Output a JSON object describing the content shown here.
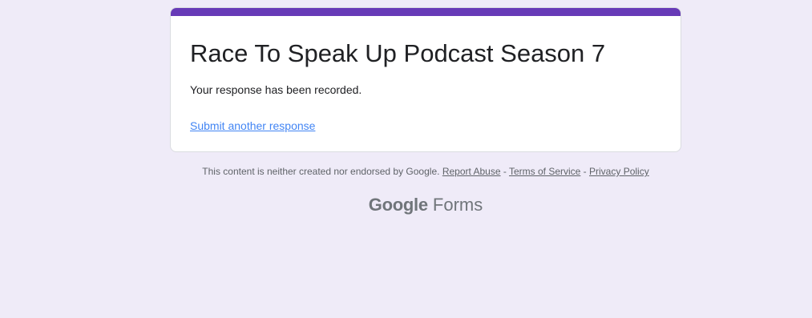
{
  "form": {
    "title": "Race To Speak Up Podcast Season 7",
    "confirmation_message": "Your response has been recorded.",
    "submit_another_label": "Submit another response",
    "accent_color": "#673ab7"
  },
  "footer": {
    "disclaimer": "This content is neither created nor endorsed by Google.",
    "links": {
      "report_abuse": "Report Abuse",
      "terms": "Terms of Service",
      "privacy": "Privacy Policy"
    },
    "separator": " - "
  },
  "brand": {
    "google": "Google",
    "forms": "Forms"
  },
  "colors": {
    "background": "#efebf8",
    "link": "#4285f4"
  }
}
